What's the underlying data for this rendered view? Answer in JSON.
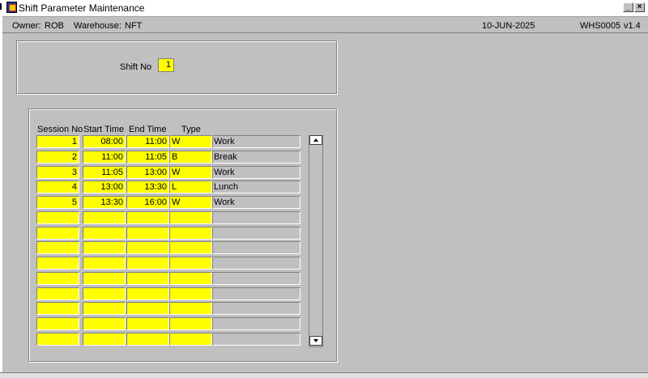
{
  "window": {
    "title": "Shift Parameter Maintenance"
  },
  "infobar": {
    "owner_label": "Owner:",
    "owner_value": "ROB",
    "warehouse_label": "Warehouse:",
    "warehouse_value": "NFT",
    "date": "10-JUN-2025",
    "program": "WHS0005",
    "version": "v1.4"
  },
  "header_form": {
    "shift_label": "Shift No",
    "shift_value": "1"
  },
  "table": {
    "columns": [
      "Session No",
      "Start Time",
      "End Time",
      "Type"
    ],
    "rows": [
      {
        "session": "1",
        "start": "08:00",
        "end": "11:00",
        "type": "W",
        "desc": "Work"
      },
      {
        "session": "2",
        "start": "11:00",
        "end": "11:05",
        "type": "B",
        "desc": "Break"
      },
      {
        "session": "3",
        "start": "11:05",
        "end": "13:00",
        "type": "W",
        "desc": "Work"
      },
      {
        "session": "4",
        "start": "13:00",
        "end": "13:30",
        "type": "L",
        "desc": "Lunch"
      },
      {
        "session": "5",
        "start": "13:30",
        "end": "16:00",
        "type": "W",
        "desc": "Work"
      },
      {
        "session": "",
        "start": "",
        "end": "",
        "type": "",
        "desc": ""
      },
      {
        "session": "",
        "start": "",
        "end": "",
        "type": "",
        "desc": ""
      },
      {
        "session": "",
        "start": "",
        "end": "",
        "type": "",
        "desc": ""
      },
      {
        "session": "",
        "start": "",
        "end": "",
        "type": "",
        "desc": ""
      },
      {
        "session": "",
        "start": "",
        "end": "",
        "type": "",
        "desc": ""
      },
      {
        "session": "",
        "start": "",
        "end": "",
        "type": "",
        "desc": ""
      },
      {
        "session": "",
        "start": "",
        "end": "",
        "type": "",
        "desc": ""
      },
      {
        "session": "",
        "start": "",
        "end": "",
        "type": "",
        "desc": ""
      },
      {
        "session": "",
        "start": "",
        "end": "",
        "type": "",
        "desc": ""
      }
    ]
  },
  "icons": {
    "app": "app-icon",
    "minimize": "minimize-icon",
    "close": "close-icon",
    "scroll_up": "scroll-up-icon",
    "scroll_down": "scroll-down-icon"
  },
  "colors": {
    "field_bg": "#ffff00",
    "window_bg": "#c0c0c0"
  }
}
